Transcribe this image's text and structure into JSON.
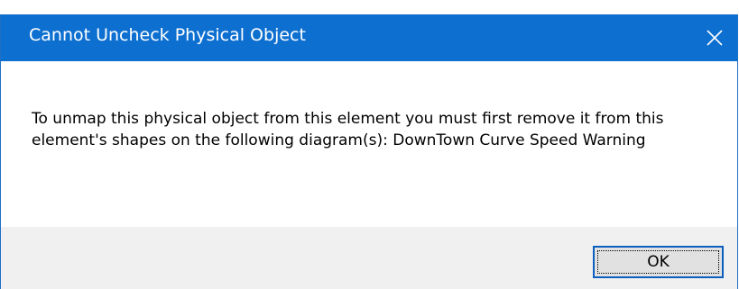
{
  "dialog": {
    "title": "Cannot Uncheck Physical Object",
    "message": "To unmap this physical object from this element you must first remove it from this element's shapes on the following diagram(s): DownTown Curve Speed Warning",
    "ok_label": "OK",
    "close_icon": "close-icon"
  },
  "colors": {
    "titlebar": "#0d6fd0",
    "title_text": "#ffffff",
    "footer": "#f0f0f0",
    "button_border": "#0b5fbf",
    "button_face": "#e1e1e1"
  }
}
